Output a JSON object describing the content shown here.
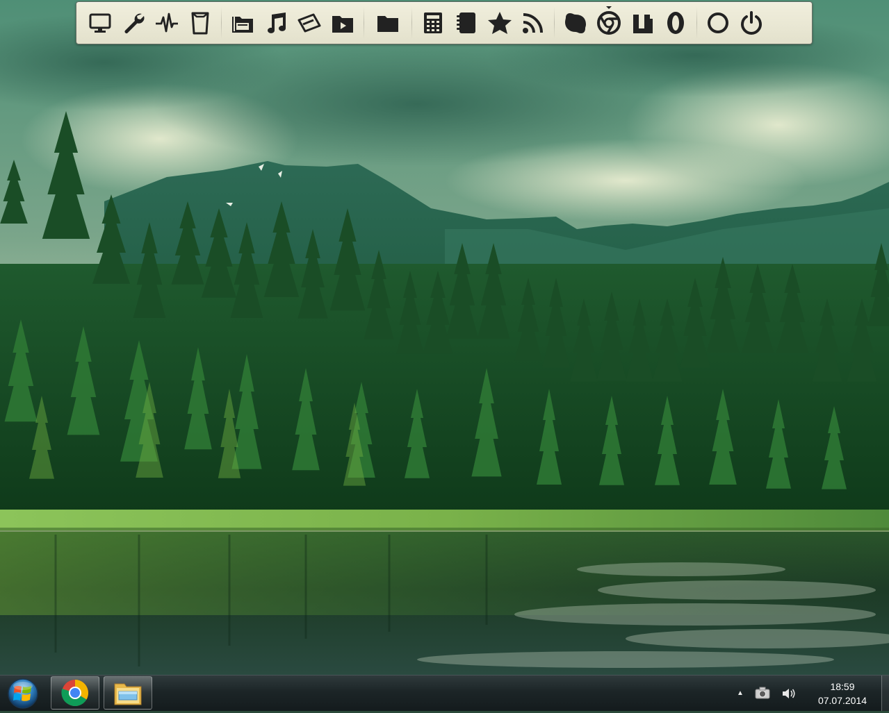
{
  "dock": {
    "groups": [
      {
        "icons": [
          {
            "name": "monitor-icon"
          },
          {
            "name": "wrench-icon"
          },
          {
            "name": "pulse-icon"
          },
          {
            "name": "trash-icon"
          }
        ]
      },
      {
        "icons": [
          {
            "name": "drive-icon"
          },
          {
            "name": "music-icon"
          },
          {
            "name": "pictures-icon"
          },
          {
            "name": "videos-folder-icon"
          }
        ]
      },
      {
        "icons": [
          {
            "name": "folder-icon"
          }
        ]
      },
      {
        "icons": [
          {
            "name": "calculator-icon"
          },
          {
            "name": "notebook-icon"
          },
          {
            "name": "star-icon"
          },
          {
            "name": "rss-icon"
          }
        ]
      },
      {
        "icons": [
          {
            "name": "skype-icon"
          },
          {
            "name": "chrome-icon",
            "running": true
          },
          {
            "name": "utorrent-icon"
          },
          {
            "name": "opera-icon"
          }
        ]
      },
      {
        "icons": [
          {
            "name": "record-icon"
          },
          {
            "name": "power-icon"
          }
        ]
      }
    ]
  },
  "taskbar": {
    "pinned": [
      {
        "name": "chrome-taskbar-icon"
      },
      {
        "name": "explorer-taskbar-icon"
      }
    ],
    "tray": {
      "show_hidden_label": "▲",
      "time": "18:59",
      "date": "07.07.2014"
    }
  }
}
